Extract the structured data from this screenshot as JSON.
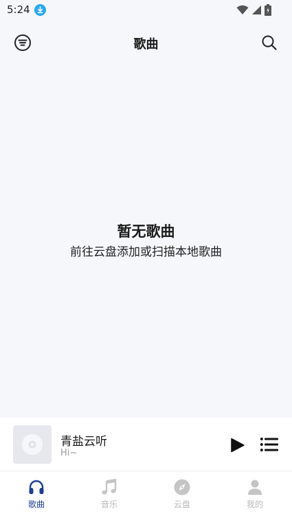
{
  "status_bar": {
    "time": "5:24"
  },
  "header": {
    "title": "歌曲"
  },
  "empty_state": {
    "title": "暂无歌曲",
    "subtitle": "前往云盘添加或扫描本地歌曲"
  },
  "player": {
    "title": "青盐云听",
    "subtitle": "Hi~"
  },
  "tabs": [
    {
      "label": "歌曲",
      "icon": "headphones-icon",
      "active": true
    },
    {
      "label": "音乐",
      "icon": "music-note-icon",
      "active": false
    },
    {
      "label": "云盘",
      "icon": "compass-icon",
      "active": false
    },
    {
      "label": "我的",
      "icon": "person-icon",
      "active": false
    }
  ],
  "colors": {
    "accent": "#1d3f8f",
    "download_badge": "#29a8f0",
    "inactive": "#c5c5c5",
    "background": "#f6f7fb"
  }
}
